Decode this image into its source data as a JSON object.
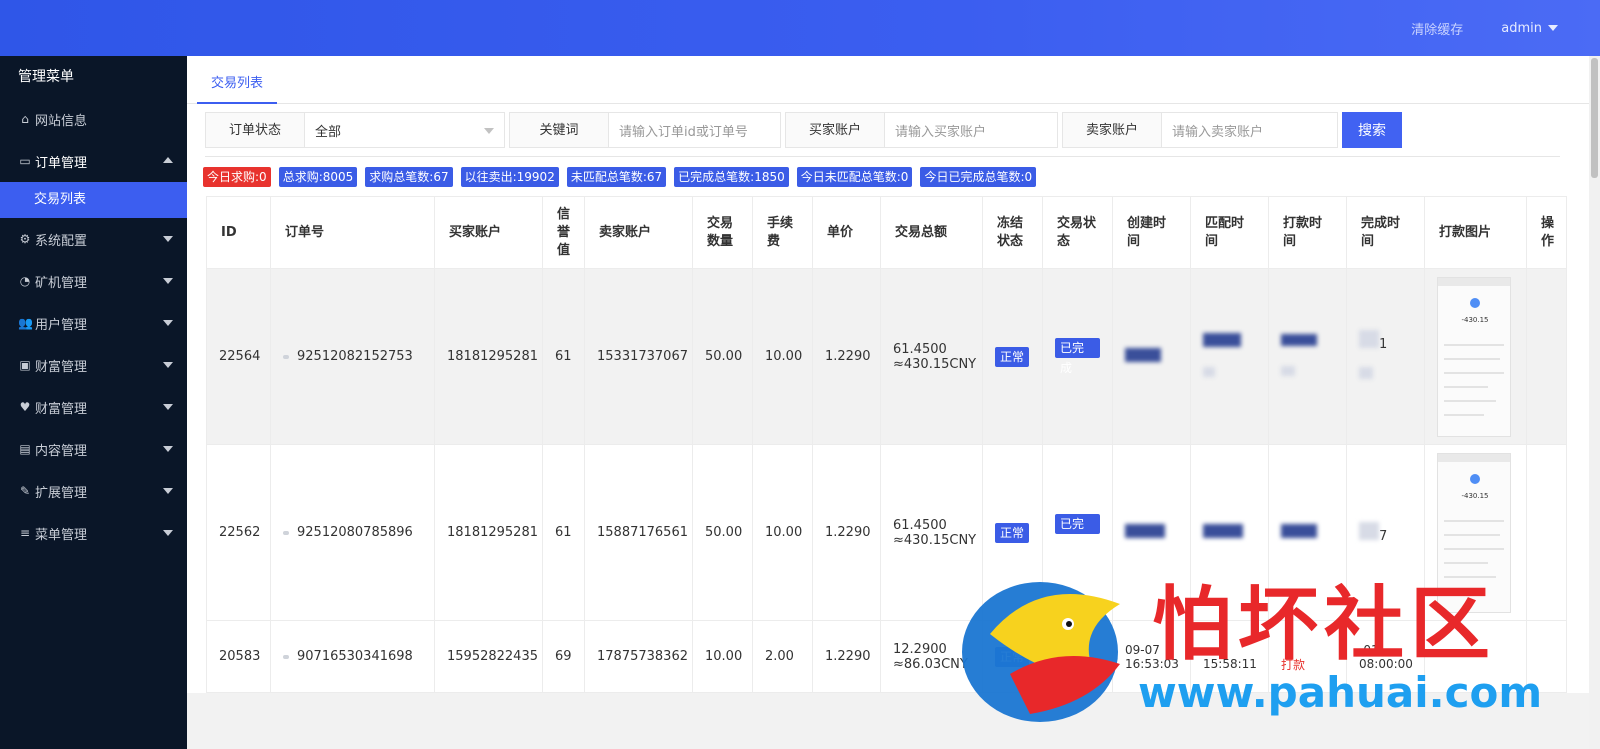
{
  "header": {
    "clear_cache": "清除缓存",
    "user": "admin"
  },
  "sidebar": {
    "title": "管理菜单",
    "items": [
      {
        "label": "网站信息",
        "icon": "home-icon"
      },
      {
        "label": "订单管理",
        "icon": "card-icon",
        "open": true
      },
      {
        "label": "系统配置",
        "icon": "gears-icon"
      },
      {
        "label": "矿机管理",
        "icon": "dashboard-icon"
      },
      {
        "label": "用户管理",
        "icon": "users-icon"
      },
      {
        "label": "财富管理",
        "icon": "money-icon"
      },
      {
        "label": "财富管理",
        "icon": "heartbeat-icon"
      },
      {
        "label": "内容管理",
        "icon": "file-icon"
      },
      {
        "label": "扩展管理",
        "icon": "wrench-icon"
      },
      {
        "label": "菜单管理",
        "icon": "bars-icon"
      }
    ],
    "sub_active": "交易列表"
  },
  "tabs": {
    "active": "交易列表"
  },
  "filters": {
    "status_label": "订单状态",
    "status_value": "全部",
    "keyword_label": "关键词",
    "keyword_placeholder": "请输入订单id或订单号",
    "buyer_label": "买家账户",
    "buyer_placeholder": "请输入买家账户",
    "seller_label": "卖家账户",
    "seller_placeholder": "请输入卖家账户",
    "search_btn": "搜索"
  },
  "badges": [
    {
      "text": "今日求购:0",
      "color": "#e8332e"
    },
    {
      "text": "总求购:8005"
    },
    {
      "text": "求购总笔数:67"
    },
    {
      "text": "以往卖出:19902"
    },
    {
      "text": "未匹配总笔数:67"
    },
    {
      "text": "已完成总笔数:1850"
    },
    {
      "text": "今日未匹配总笔数:0"
    },
    {
      "text": "今日已完成总笔数:0"
    }
  ],
  "table": {
    "headers": [
      "ID",
      "订单号",
      "买家账户",
      "信\n誉\n值",
      "卖家账户",
      "交易\n数量",
      "手续\n费",
      "单价",
      "交易总额",
      "冻结\n状态",
      "交易状\n态",
      "创建时\n间",
      "匹配时\n间",
      "打款时\n间",
      "完成时\n间",
      "打款图片",
      "操\n作"
    ],
    "rows": [
      {
        "id": "22564",
        "order": "92512082152753",
        "buyer": "18181295281",
        "credit": "61",
        "seller": "15331737067",
        "qty": "50.00",
        "fee": "10.00",
        "price": "1.2290",
        "total1": "61.4500",
        "total2": "≈430.15CNY",
        "freeze": "正常",
        "status": "已完成",
        "done_suffix": "1",
        "proof_amount": "-430.15"
      },
      {
        "id": "22562",
        "order": "92512080785896",
        "buyer": "18181295281",
        "credit": "61",
        "seller": "15887176561",
        "qty": "50.00",
        "fee": "10.00",
        "price": "1.2290",
        "total1": "61.4500",
        "total2": "≈430.15CNY",
        "freeze": "正常",
        "status": "已完成",
        "done_suffix": "7",
        "proof_amount": "-430.15"
      },
      {
        "id": "20583",
        "order": "90716530341698",
        "buyer": "15952822435",
        "credit": "69",
        "seller": "17875738362",
        "qty": "10.00",
        "fee": "2.00",
        "price": "1.2290",
        "total1": "12.2900",
        "total2": "≈86.03CNY",
        "freeze": "正常",
        "created": "09-07",
        "created_t": "16:53:03",
        "matched_t": "15:58:11",
        "paid": "打款",
        "done": "-01",
        "done_t": "08:00:00"
      }
    ]
  },
  "watermark": {
    "text": "怕坏社区",
    "url": "www.pahuai.com"
  },
  "colors": {
    "primary": "#3c5ef0",
    "danger": "#e8332e",
    "sidebar_bg": "#0a1628"
  }
}
